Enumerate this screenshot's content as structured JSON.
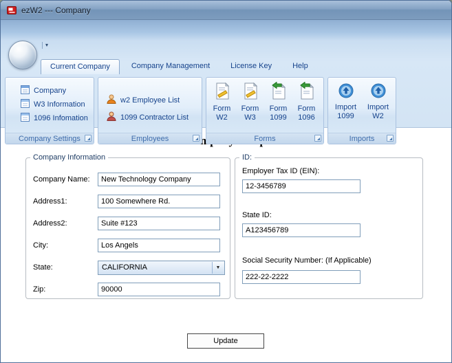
{
  "window": {
    "title": "ezW2 --- Company"
  },
  "qat": {
    "chevron": "▾"
  },
  "tabs": {
    "items": [
      {
        "label": "Current Company"
      },
      {
        "label": "Company Management"
      },
      {
        "label": "License Key"
      },
      {
        "label": "Help"
      }
    ]
  },
  "ribbon": {
    "company_settings": {
      "caption": "Company Settings",
      "items": [
        {
          "label": "Company"
        },
        {
          "label": "W3 Information"
        },
        {
          "label": "1096 Infomation"
        }
      ]
    },
    "employees": {
      "caption": "Employees",
      "items": [
        {
          "label": "w2 Employee List"
        },
        {
          "label": "1099 Contractor List"
        }
      ]
    },
    "forms": {
      "caption": "Forms",
      "items": [
        {
          "line1": "Form",
          "line2": "W2"
        },
        {
          "line1": "Form",
          "line2": "W3"
        },
        {
          "line1": "Form",
          "line2": "1099"
        },
        {
          "line1": "Form",
          "line2": "1096"
        }
      ]
    },
    "imports": {
      "caption": "Imports",
      "items": [
        {
          "line1": "Import",
          "line2": "1099"
        },
        {
          "line1": "Import",
          "line2": "W2"
        }
      ]
    }
  },
  "content": {
    "title": "Company Setup",
    "company_info": {
      "legend": "Company Information",
      "fields": [
        {
          "label": "Company Name:",
          "value": "New Technology Company"
        },
        {
          "label": "Address1:",
          "value": "100 Somewhere Rd."
        },
        {
          "label": "Address2:",
          "value": "Suite #123"
        },
        {
          "label": "City:",
          "value": "Los Angels"
        },
        {
          "label": "State:",
          "value": "CALIFORNIA"
        },
        {
          "label": "Zip:",
          "value": "90000"
        }
      ]
    },
    "id_info": {
      "legend": "ID:",
      "fields": [
        {
          "label": "Employer Tax ID (EIN):",
          "value": "12-3456789"
        },
        {
          "label": "State ID:",
          "value": "A123456789"
        },
        {
          "label": "Social Security Number: (If Applicable)",
          "value": "222-22-2222"
        }
      ]
    },
    "update_label": "Update",
    "combo_arrow": "▼"
  }
}
